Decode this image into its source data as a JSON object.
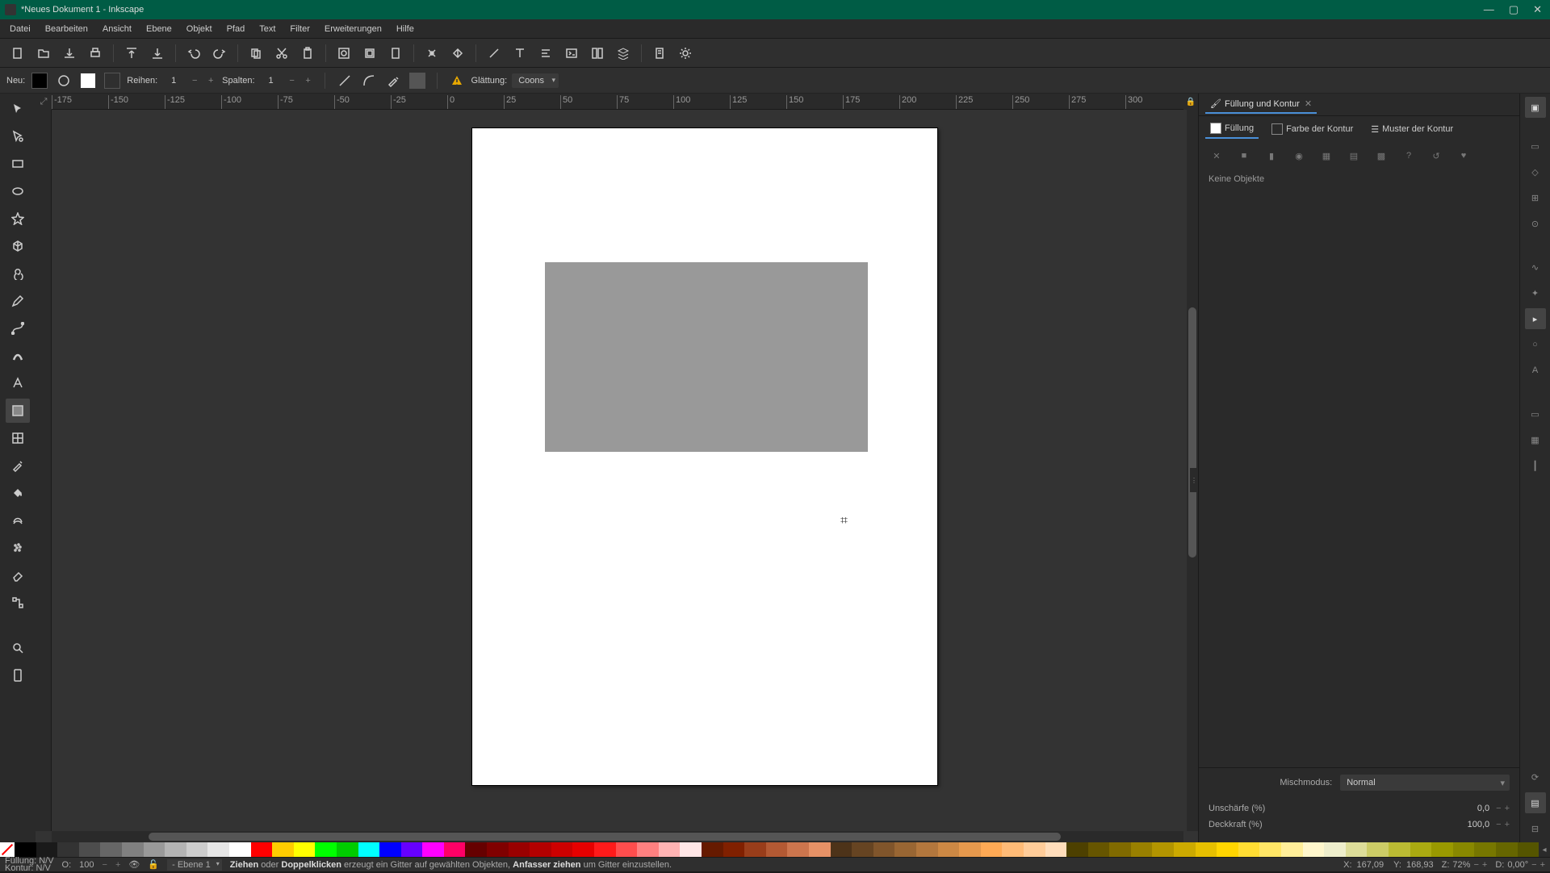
{
  "titlebar": {
    "title": "*Neues Dokument 1 - Inkscape"
  },
  "menu": [
    "Datei",
    "Bearbeiten",
    "Ansicht",
    "Ebene",
    "Objekt",
    "Pfad",
    "Text",
    "Filter",
    "Erweiterungen",
    "Hilfe"
  ],
  "toolcontrol": {
    "new_label": "Neu:",
    "rows_label": "Reihen:",
    "rows_val": "1",
    "cols_label": "Spalten:",
    "cols_val": "1",
    "smoothing_label": "Glättung:",
    "smoothing_val": "Coons"
  },
  "ruler_ticks": [
    "-175",
    "-150",
    "-125",
    "-100",
    "-75",
    "-50",
    "-25",
    "0",
    "25",
    "50",
    "75",
    "100",
    "125",
    "150",
    "175",
    "200",
    "225",
    "250",
    "275",
    "300"
  ],
  "panel": {
    "tab_title": "Füllung und Kontur",
    "fill_tab": "Füllung",
    "stroke_paint_tab": "Farbe der Kontur",
    "stroke_style_tab": "Muster der Kontur",
    "empty_msg": "Keine Objekte",
    "blend_label": "Mischmodus:",
    "blend_value": "Normal",
    "blur_label": "Unschärfe (%)",
    "blur_val": "0,0",
    "opacity_label": "Deckkraft (%)",
    "opacity_val": "100,0"
  },
  "statusbar": {
    "fill_label": "Füllung:",
    "fill_val": "N/V",
    "stroke_label": "Kontur:",
    "stroke_val": "N/V",
    "o_label": "O:",
    "o_val": "100",
    "layer": "Ebene 1",
    "hint_drag_b": "Ziehen",
    "hint_or": " oder ",
    "hint_dbl_b": "Doppelklicken",
    "hint_mid": " erzeugt ein Gitter auf gewählten Objekten, ",
    "hint_handle_b": "Anfasser ziehen",
    "hint_end": " um Gitter einzustellen.",
    "x_lbl": "X:",
    "x_val": "167,09",
    "y_lbl": "Y:",
    "y_val": "168,93",
    "z_lbl": "Z:",
    "z_val": "72%",
    "d_lbl": "D:",
    "d_val": "0,00°"
  },
  "palette_colors": [
    "#000000",
    "#1a1a1a",
    "#333333",
    "#4d4d4d",
    "#666666",
    "#808080",
    "#999999",
    "#b3b3b3",
    "#cccccc",
    "#e6e6e6",
    "#ffffff",
    "#ff0000",
    "#ffcc00",
    "#ffff00",
    "#00ff00",
    "#00cc00",
    "#00ffff",
    "#0000ff",
    "#6600ff",
    "#ff00ff",
    "#ff0066",
    "#660000",
    "#800000",
    "#990000",
    "#b30000",
    "#cc0000",
    "#e60000",
    "#ff1a1a",
    "#ff4d4d",
    "#ff8080",
    "#ffb3b3",
    "#ffe6e6",
    "#661a00",
    "#802000",
    "#993d1a",
    "#b35933",
    "#cc754d",
    "#e69166",
    "#4d3319",
    "#664422",
    "#80552b",
    "#996633",
    "#b3773d",
    "#cc8844",
    "#e6994d",
    "#ffaa55",
    "#ffbb77",
    "#ffcc99",
    "#ffddbb",
    "#4d4000",
    "#665500",
    "#806a00",
    "#998000",
    "#b39500",
    "#ccaa00",
    "#e6bf00",
    "#ffd500",
    "#ffdd33",
    "#ffe666",
    "#ffee99",
    "#fff7cc",
    "#eeeecc",
    "#dddd99",
    "#cccc66",
    "#bbbb33",
    "#aaaa11",
    "#999900",
    "#888800",
    "#777700",
    "#666600",
    "#555500"
  ]
}
